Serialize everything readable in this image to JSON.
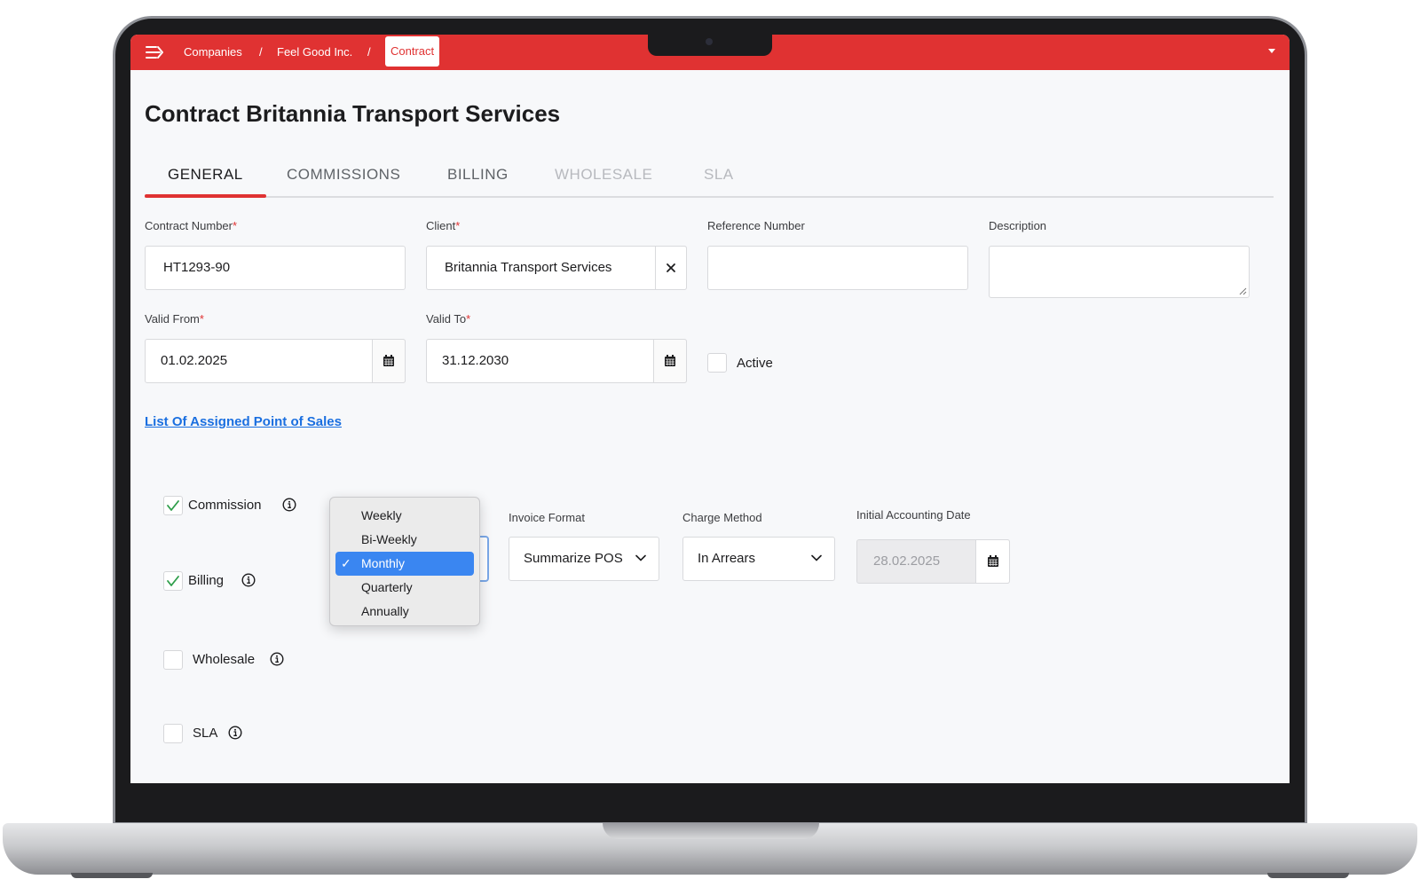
{
  "breadcrumb": {
    "items": [
      "Companies",
      "Feel Good Inc."
    ],
    "separator": "/",
    "current": "Contract"
  },
  "page": {
    "title": "Contract Britannia Transport Services"
  },
  "tabs": [
    {
      "label": "GENERAL",
      "state": "active"
    },
    {
      "label": "COMMISSIONS",
      "state": "normal"
    },
    {
      "label": "BILLING",
      "state": "normal"
    },
    {
      "label": "WHOLESALE",
      "state": "disabled"
    },
    {
      "label": "SLA",
      "state": "disabled"
    }
  ],
  "form": {
    "contract_number": {
      "label": "Contract Number",
      "required_mark": "*",
      "value": "HT1293-90"
    },
    "client": {
      "label": "Client",
      "required_mark": "*",
      "value": "Britannia Transport Services",
      "clear_icon": "close-icon"
    },
    "reference_number": {
      "label": "Reference Number",
      "value": ""
    },
    "description": {
      "label": "Description",
      "value": ""
    },
    "valid_from": {
      "label": "Valid From",
      "required_mark": "*",
      "value": "01.02.2025",
      "icon": "calendar-icon"
    },
    "valid_to": {
      "label": "Valid To",
      "required_mark": "*",
      "value": "31.12.2030",
      "icon": "calendar-icon"
    },
    "active": {
      "label": "Active",
      "checked": false
    }
  },
  "link": {
    "assigned_pos": "List Of Assigned Point of Sales"
  },
  "features": [
    {
      "label": "Commission",
      "checked": true
    },
    {
      "label": "Billing",
      "checked": true
    },
    {
      "label": "Wholesale",
      "checked": false
    },
    {
      "label": "SLA",
      "checked": false
    }
  ],
  "billing": {
    "frequency_options": [
      "Weekly",
      "Bi-Weekly",
      "Monthly",
      "Quarterly",
      "Annually"
    ],
    "frequency_selected": "Monthly",
    "check_mark": "✓",
    "invoice_format": {
      "label": "Invoice Format",
      "value": "Summarize POS"
    },
    "charge_method": {
      "label": "Charge Method",
      "value": "In Arrears"
    },
    "initial_accounting_date": {
      "label": "Initial Accounting Date",
      "value": "28.02.2025",
      "disabled": true
    }
  },
  "colors": {
    "brand": "#e03232",
    "link": "#1a6fe0",
    "selection": "#3a86f1",
    "check": "#2e9e4a"
  }
}
